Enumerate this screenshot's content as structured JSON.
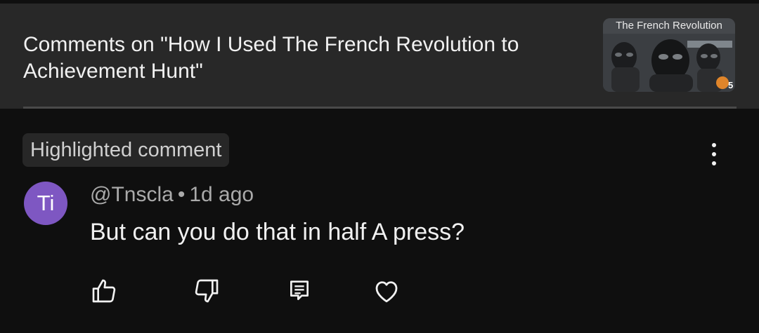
{
  "header": {
    "title": "Comments on \"How I Used The French Revolution to Achievement Hunt\"",
    "thumbnail": {
      "caption": "The French Revolution",
      "icon": "thumbnail-image"
    }
  },
  "comment": {
    "badge": "Highlighted comment",
    "avatar_initials": "Ti",
    "avatar_color": "#7e57c2",
    "author": "@Tnscla",
    "separator": "•",
    "time": "1d ago",
    "text": "But can you do that in half A press?",
    "menu_icon": "more-vertical-icon",
    "actions": {
      "like_icon": "thumbs-up-icon",
      "dislike_icon": "thumbs-down-icon",
      "reply_icon": "reply-icon",
      "heart_icon": "heart-icon"
    }
  },
  "colors": {
    "background": "#0f0f0f",
    "header_background": "#282828",
    "text_primary": "#f1f1f1",
    "text_secondary": "#aaaaaa"
  }
}
